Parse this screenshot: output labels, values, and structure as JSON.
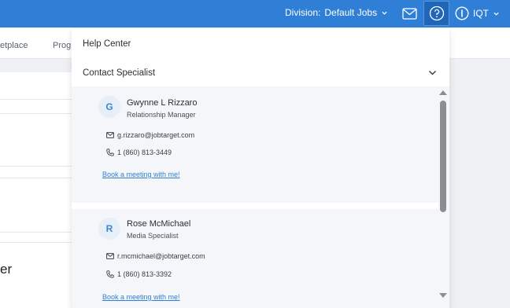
{
  "topbar": {
    "division_label": "Division:",
    "division_value": "Default Jobs",
    "user_label": "IQT",
    "colors": {
      "bar": "#2f7fd6",
      "help_active": "#1f66b8"
    }
  },
  "subnav": {
    "items": [
      "etplace",
      "Prog"
    ]
  },
  "background": {
    "heading": "er"
  },
  "dropdown": {
    "help_center": "Help Center",
    "contact_specialist": "Contact Specialist",
    "contacts": [
      {
        "initial": "G",
        "name": "Gwynne L Rizzaro",
        "role": "Relationship Manager",
        "email": "g.rizzaro@jobtarget.com",
        "phone": "1 (860) 813-3449",
        "book": "Book a meeting with me!"
      },
      {
        "initial": "R",
        "name": "Rose McMichael",
        "role": "Media Specialist",
        "email": "r.mcmichael@jobtarget.com",
        "phone": "1 (860) 813-3392",
        "book": "Book a meeting with me!"
      }
    ]
  }
}
